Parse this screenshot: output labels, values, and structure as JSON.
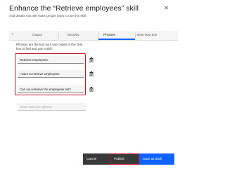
{
  "dialog": {
    "title": "Enhance the “Retrieve employees” skill",
    "subtitle": "Add details that will make people want to use this skill.",
    "close_icon": "close-icon"
  },
  "tabs": [
    {
      "label": "Output",
      "active": false
    },
    {
      "label": "Security",
      "active": false
    },
    {
      "label": "Phrases",
      "active": true
    },
    {
      "label": "Next best acti",
      "active": false
    }
  ],
  "tab_nav_icon": "chevron-left-icon",
  "phrases": {
    "instructions": "Phrases are the text your user types in the chat box to find and use a skill.",
    "items": [
      {
        "text": "Retrieve employees."
      },
      {
        "text": "I want to retrieve employees."
      },
      {
        "text": "Can you retrieve the employees list?"
      }
    ],
    "delete_icon": "trash-icon",
    "new_placeholder": "Enter new user phrase"
  },
  "footer": {
    "cancel_label": "Cancel",
    "publish_label": "Publish",
    "save_label": "Save as draft"
  },
  "colors": {
    "accent": "#0f62fe",
    "highlight": "#c8102e",
    "button_dark": "#393939"
  }
}
